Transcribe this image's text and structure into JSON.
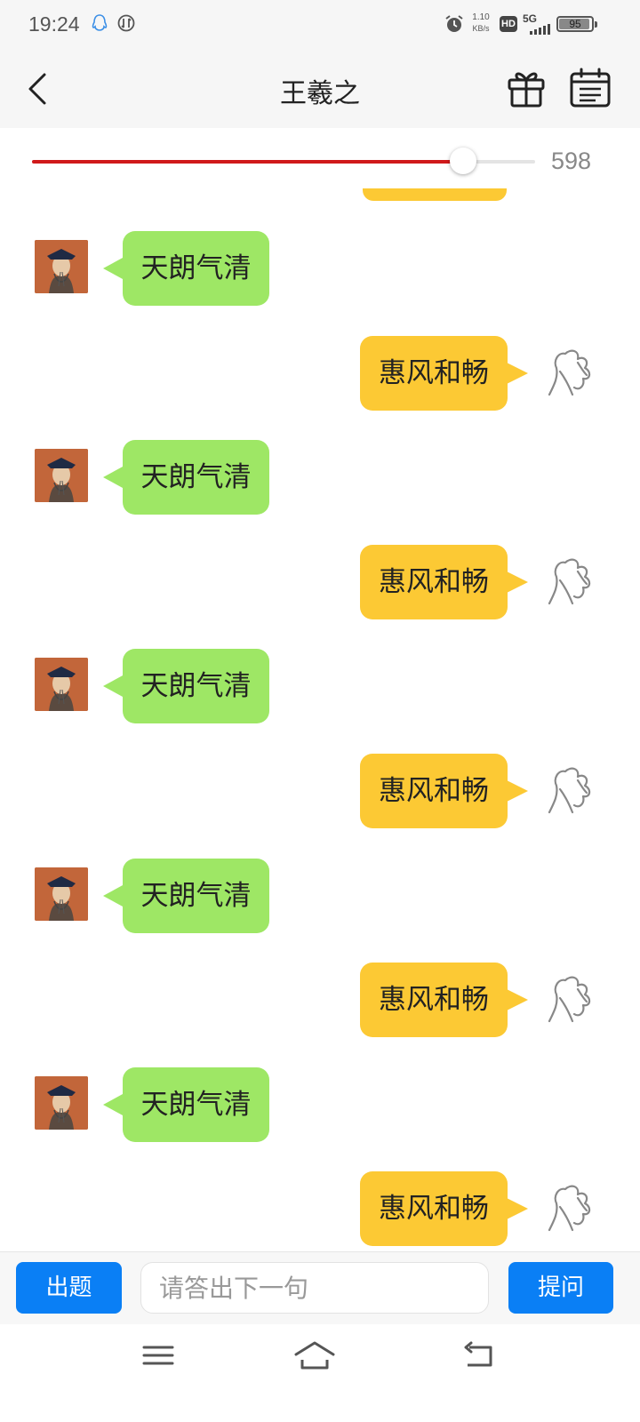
{
  "status_bar": {
    "time": "19:24",
    "net_speed_value": "1.10",
    "net_speed_unit": "KB/s",
    "hd_label": "HD",
    "signal_label": "5G",
    "battery_level": "95",
    "icons": [
      "qq-icon",
      "data-saver-icon",
      "alarm-icon",
      "signal-icon",
      "battery-icon"
    ]
  },
  "header": {
    "title": "王羲之",
    "icons": [
      "back-icon",
      "gift-icon",
      "calendar-icon"
    ]
  },
  "progress": {
    "value_fraction": 0.857,
    "count": "598",
    "fill_color": "#d0191a"
  },
  "chat": {
    "left_color": "#9ee765",
    "right_color": "#fcc934",
    "messages": [
      {
        "side": "left",
        "text": "天朗气清"
      },
      {
        "side": "right",
        "text": "惠风和畅"
      },
      {
        "side": "left",
        "text": "天朗气清"
      },
      {
        "side": "right",
        "text": "惠风和畅"
      },
      {
        "side": "left",
        "text": "天朗气清"
      },
      {
        "side": "right",
        "text": "惠风和畅"
      },
      {
        "side": "left",
        "text": "天朗气清"
      },
      {
        "side": "right",
        "text": "惠风和畅"
      },
      {
        "side": "left",
        "text": "天朗气清"
      },
      {
        "side": "right",
        "text": "惠风和畅"
      }
    ]
  },
  "input_bar": {
    "question_button": "出题",
    "input_placeholder": "请答出下一句",
    "ask_button": "提问",
    "button_color": "#0a7ff5"
  },
  "nav_bar": {
    "icons": [
      "menu-icon",
      "home-icon",
      "back-nav-icon"
    ]
  }
}
